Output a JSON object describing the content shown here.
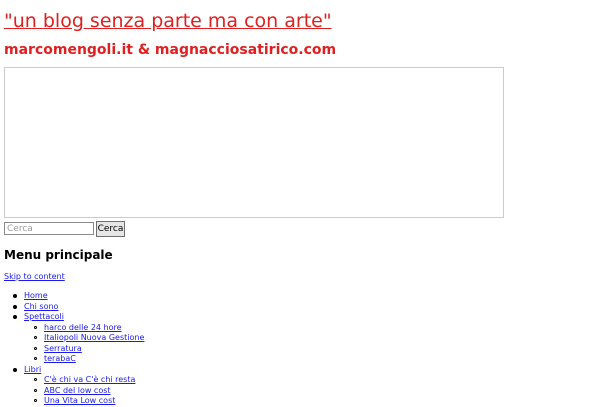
{
  "header": {
    "title": "\"un blog senza parte ma con arte\"",
    "description": "marcomengoli.it & magnacciosatirico.com"
  },
  "search": {
    "placeholder": "Cerca",
    "button_label": "Cerca"
  },
  "nav": {
    "heading": "Menu principale",
    "skip_link": "Skip to content",
    "items": [
      {
        "label": "Home",
        "children": []
      },
      {
        "label": "Chi sono",
        "children": []
      },
      {
        "label": "Spettacoli",
        "children": [
          "harco delle 24 hore",
          "Italiopoli Nuova Gestione",
          "Serratura",
          "terabaC"
        ]
      },
      {
        "label": "Libri",
        "children": [
          "C'è chi va C'è chi resta",
          "ABC del low cost",
          "Una Vita Low cost"
        ]
      }
    ]
  },
  "colors": {
    "accent": "#e02020",
    "link": "#1a1aee"
  }
}
